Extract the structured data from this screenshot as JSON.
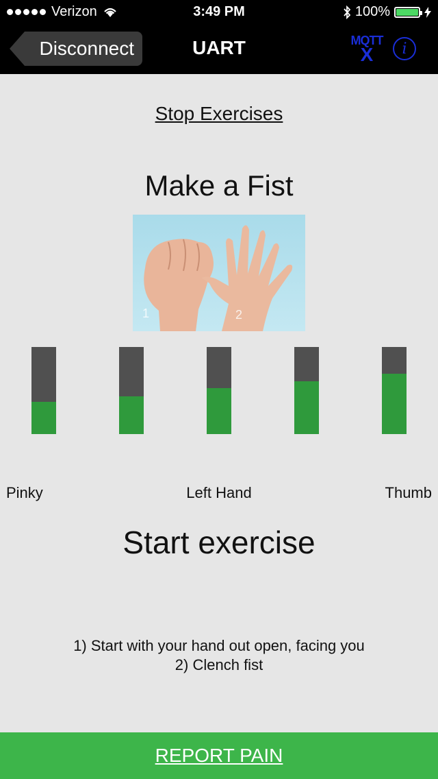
{
  "status_bar": {
    "carrier": "Verizon",
    "time": "3:49 PM",
    "battery": "100%"
  },
  "nav": {
    "back_label": "Disconnect",
    "title": "UART",
    "mqtt_line1": "MQTT",
    "mqtt_line2": "X",
    "info_glyph": "i"
  },
  "stop_label": "Stop Exercises",
  "exercise": {
    "title": "Make a Fist",
    "image_icon": "hand-fist-photo"
  },
  "fingers": [
    {
      "level": 0.37
    },
    {
      "level": 0.43
    },
    {
      "level": 0.53
    },
    {
      "level": 0.61
    },
    {
      "level": 0.69
    }
  ],
  "labels": {
    "left": "Pinky",
    "center": "Left Hand",
    "right": "Thumb"
  },
  "status_text": "Start exercise",
  "instructions": {
    "line1": "1) Start with your hand out open, facing you",
    "line2": "2) Clench fist"
  },
  "report_label": "REPORT PAIN",
  "colors": {
    "bar_fill": "#2f9a3c",
    "bar_track": "#505050",
    "report": "#3db54a",
    "mqtt_blue": "#1a2ed8"
  }
}
